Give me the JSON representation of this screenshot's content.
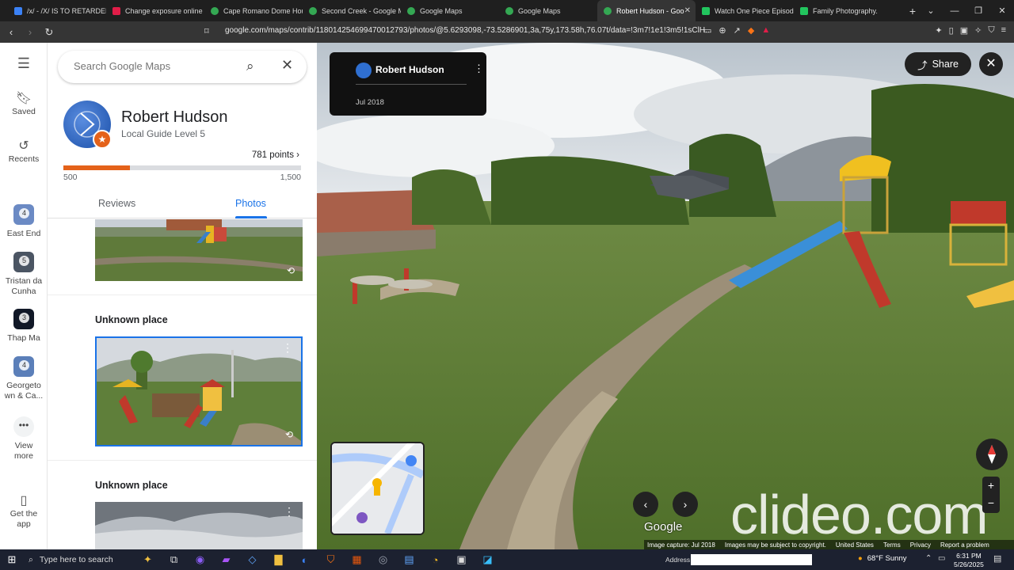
{
  "browser": {
    "tabs": [
      {
        "label": "/x/ - /X/ IS TO RETARDED",
        "color": "#3b82f6"
      },
      {
        "label": "Change exposure online",
        "color": "#e11d48"
      },
      {
        "label": "Cape Romano Dome Hou",
        "color": "#34a853"
      },
      {
        "label": "Second Creek - Google M",
        "color": "#34a853"
      },
      {
        "label": "Google Maps",
        "color": "#34a853"
      },
      {
        "label": "Google Maps",
        "color": "#34a853"
      },
      {
        "label": "Robert Hudson - Goo",
        "color": "#34a853",
        "active": true
      },
      {
        "label": "Watch One Piece Episode",
        "color": "#22c55e"
      },
      {
        "label": "Family Photography.",
        "color": "#22c55e"
      }
    ],
    "url": "google.com/maps/contrib/118014254699470012793/photos/@5.6293098,-73.5286901,3a,75y,173.58h,76.07t/data=!3m7!1e1!3m5!1sClH..."
  },
  "rail": {
    "menu_icon": "menu-icon",
    "saved": "Saved",
    "recents": "Recents",
    "places": [
      {
        "label": "East End",
        "count": "4",
        "color": "#6b8ac4"
      },
      {
        "label": "Tristan da Cunha",
        "count": "5",
        "color": "#4b5563"
      },
      {
        "label": "Thap Ma",
        "count": "3",
        "color": "#111827"
      },
      {
        "label": "Georgeto wn & Ca...",
        "count": "4",
        "color": "#5b7fb9"
      }
    ],
    "view_more": "View more",
    "get_app": "Get the app"
  },
  "panel": {
    "search_placeholder": "Search Google Maps",
    "profile": {
      "name": "Robert Hudson",
      "level": "Local Guide Level 5",
      "points": "781 points",
      "progress_min": "500",
      "progress_max": "1,500",
      "progress_fraction": 0.281
    },
    "tabs": [
      "Reviews",
      "Photos"
    ],
    "active_tab": "Photos",
    "cards": [
      {
        "place": "Unknown place"
      },
      {
        "place": "Unknown place"
      }
    ]
  },
  "viewer": {
    "author": "Robert Hudson",
    "date": "Jul 2018",
    "share_label": "Share",
    "google_logo": "Google",
    "watermark": "clideo.com",
    "footer": [
      "Image capture: Jul 2018",
      "Images may be subject to copyright.",
      "United States",
      "Terms",
      "Privacy",
      "Report a problem"
    ]
  },
  "taskbar": {
    "search_placeholder": "Type here to search",
    "address_label": "Address",
    "weather": "68°F  Sunny",
    "time": "6:31 PM",
    "date": "5/26/2025"
  }
}
